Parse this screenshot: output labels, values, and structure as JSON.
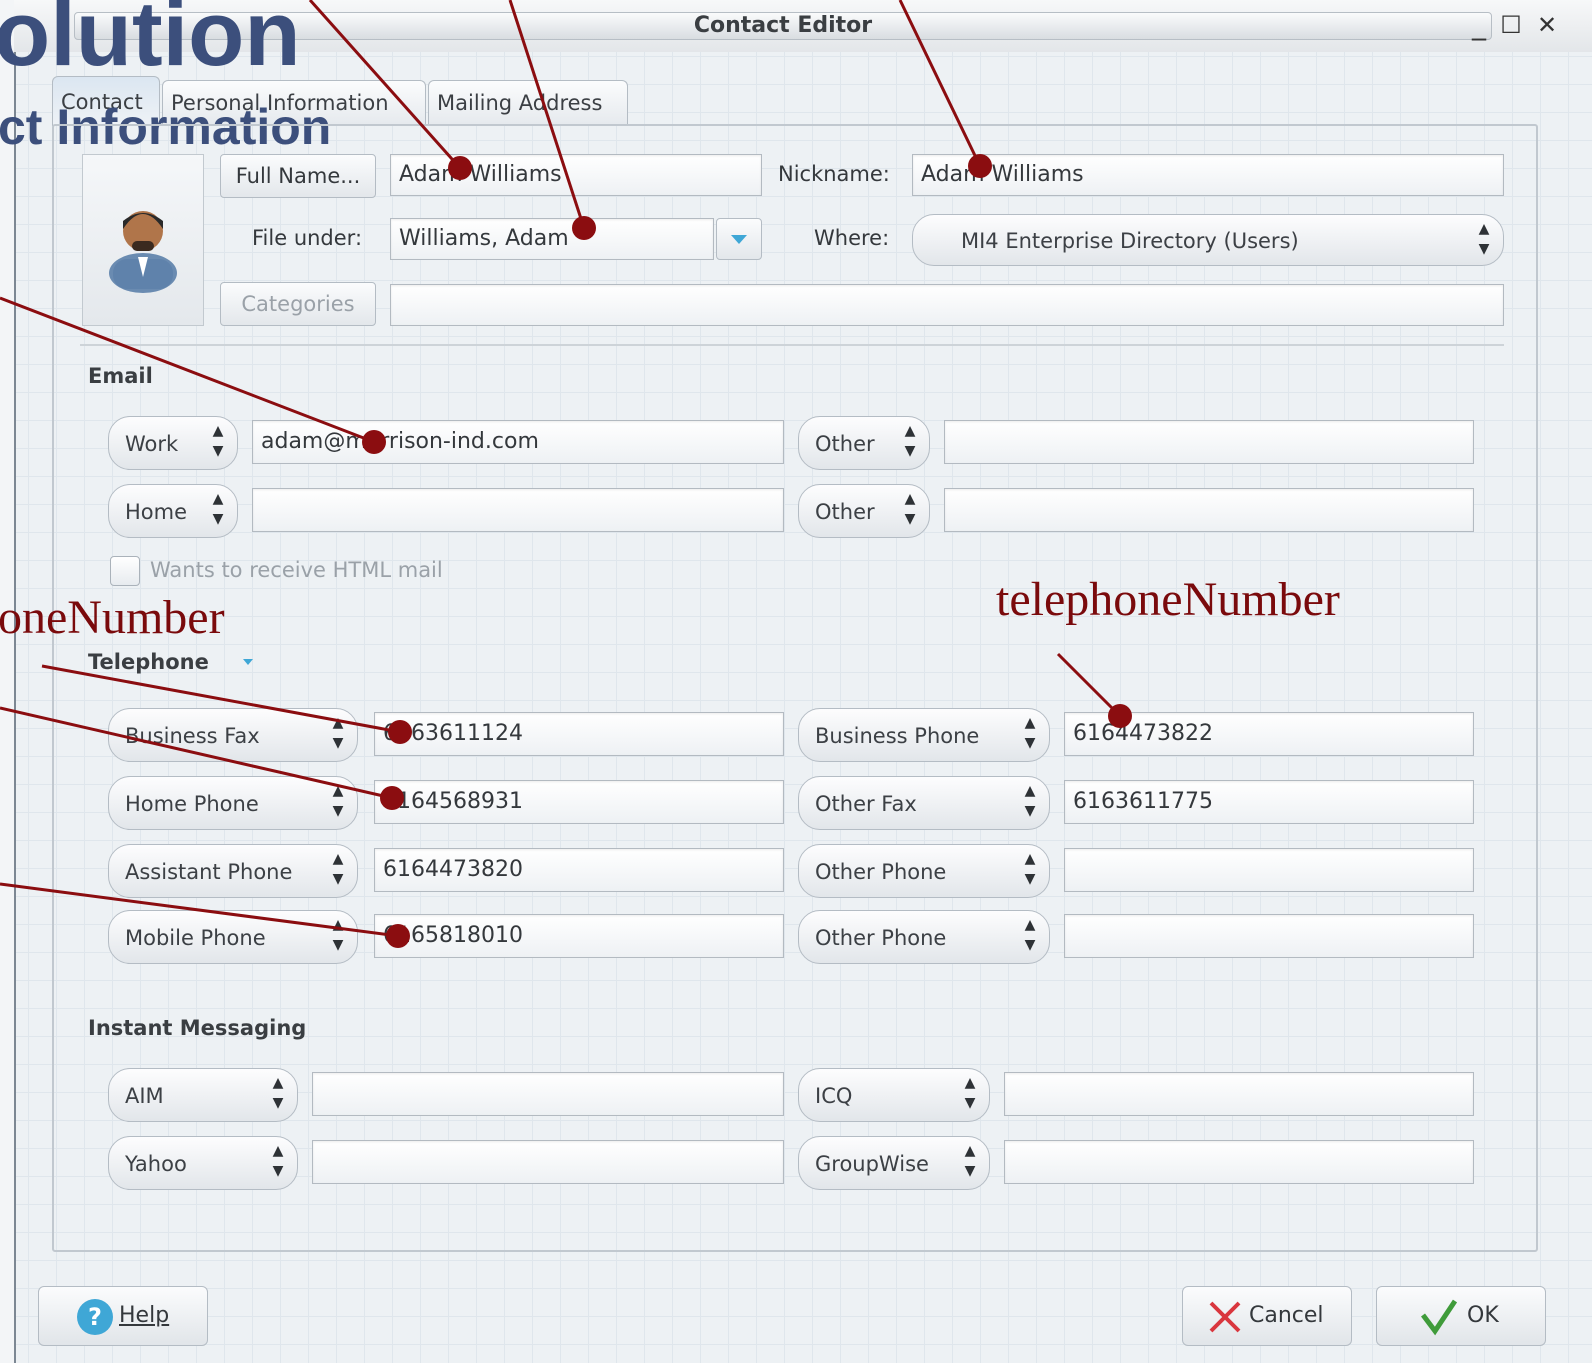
{
  "window": {
    "title": "Contact Editor",
    "controls": {
      "minimize": "_",
      "maximize": "☐",
      "close": "✕"
    }
  },
  "watermark": {
    "line1": "olution",
    "line2": "ct Information"
  },
  "tabs": [
    {
      "label": "Contact",
      "active": true
    },
    {
      "label": "Personal Information",
      "active": false
    },
    {
      "label": "Mailing Address",
      "active": false
    }
  ],
  "identity": {
    "full_name_button": "Full Name...",
    "full_name_value": "Adam Williams",
    "nickname_label": "Nickname:",
    "nickname_value": "Adam Williams",
    "file_under_label": "File under:",
    "file_under_value": "Williams, Adam",
    "where_label": "Where:",
    "where_value": "MI4 Enterprise Directory (Users)",
    "categories_button": "Categories",
    "categories_value": ""
  },
  "email": {
    "section": "Email",
    "rows": [
      {
        "type": "Work",
        "value": "adam@morrison-ind.com",
        "type2": "Other",
        "value2": ""
      },
      {
        "type": "Home",
        "value": "",
        "type2": "Other",
        "value2": ""
      }
    ],
    "html_mail_label": "Wants to receive HTML mail"
  },
  "telephone": {
    "section": "Telephone",
    "rows": [
      {
        "type": "Business Fax",
        "value": "6163611124",
        "type2": "Business Phone",
        "value2": "6164473822"
      },
      {
        "type": "Home Phone",
        "value": "6164568931",
        "type2": "Other Fax",
        "value2": "6163611775"
      },
      {
        "type": "Assistant Phone",
        "value": "6164473820",
        "type2": "Other Phone",
        "value2": ""
      },
      {
        "type": "Mobile Phone",
        "value": "6165818010",
        "type2": "Other Phone",
        "value2": ""
      }
    ]
  },
  "im": {
    "section": "Instant Messaging",
    "rows": [
      {
        "type": "AIM",
        "value": "",
        "type2": "ICQ",
        "value2": ""
      },
      {
        "type": "Yahoo",
        "value": "",
        "type2": "GroupWise",
        "value2": ""
      }
    ]
  },
  "footer": {
    "help": "Help",
    "cancel": "Cancel",
    "ok": "OK"
  },
  "annotations": {
    "left_label": "oneNumber",
    "right_label": "telephoneNumber",
    "line_color": "#8b0d10"
  },
  "colors": {
    "accent_blue": "#3fa7d6",
    "watermark": "#3c4f7c",
    "cancel_x": "#d9363e",
    "ok_check": "#3f9b3a"
  }
}
